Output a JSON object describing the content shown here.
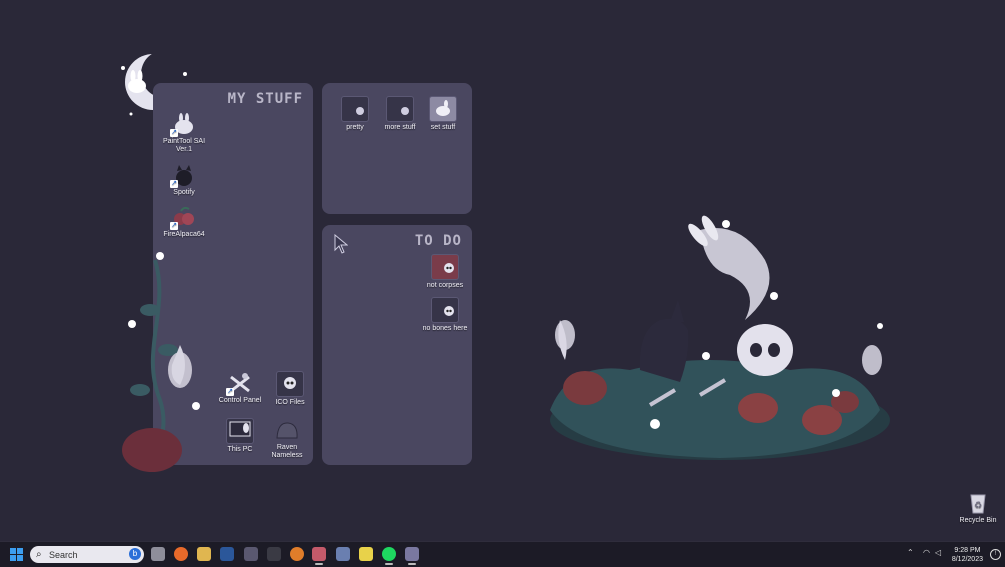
{
  "panels": {
    "my_stuff": {
      "title": "MY STUFF"
    },
    "to_do": {
      "title": "TO DO"
    }
  },
  "desktop_icons": {
    "painttool": {
      "label": "PaintTool SAI Ver.1",
      "icon": "bunny-icon"
    },
    "spotify": {
      "label": "Spotify",
      "icon": "cat-icon"
    },
    "firealpaca": {
      "label": "FireAlpaca64",
      "icon": "berry-icon"
    },
    "control_panel": {
      "label": "Control Panel",
      "icon": "bones-icon"
    },
    "ico_files": {
      "label": "ICO Files",
      "icon": "skull-icon"
    },
    "this_pc": {
      "label": "This PC",
      "icon": "monitor-icon"
    },
    "raven": {
      "label": "Raven Nameless",
      "icon": "stone-icon"
    },
    "pretty": {
      "label": "pretty",
      "icon": "folder-icon"
    },
    "more_stuff": {
      "label": "more stuff",
      "icon": "folder-icon"
    },
    "set_stuff": {
      "label": "set stuff",
      "icon": "folder-bunny-icon"
    },
    "not_corpses": {
      "label": "not corpses",
      "icon": "folder-skull-icon"
    },
    "no_bones": {
      "label": "no bones here",
      "icon": "folder-skull-icon"
    },
    "recycle_bin": {
      "label": "Recycle Bin",
      "icon": "recycle-bin-icon"
    }
  },
  "taskbar": {
    "search_placeholder": "Search",
    "apps": [
      "file-explorer-icon",
      "firefox-icon",
      "media-icon",
      "word-icon",
      "steam-icon",
      "terminal-icon",
      "fire-icon",
      "paint-icon",
      "calculator-icon",
      "notes-icon",
      "spotify-icon",
      "bunny-app-icon"
    ],
    "time": "9:28 PM",
    "date": "8/12/2023"
  },
  "colors": {
    "background": "#2a2838",
    "panel": "#4a4760",
    "taskbar": "#1c1b26",
    "accent": "#3c9ef0"
  }
}
